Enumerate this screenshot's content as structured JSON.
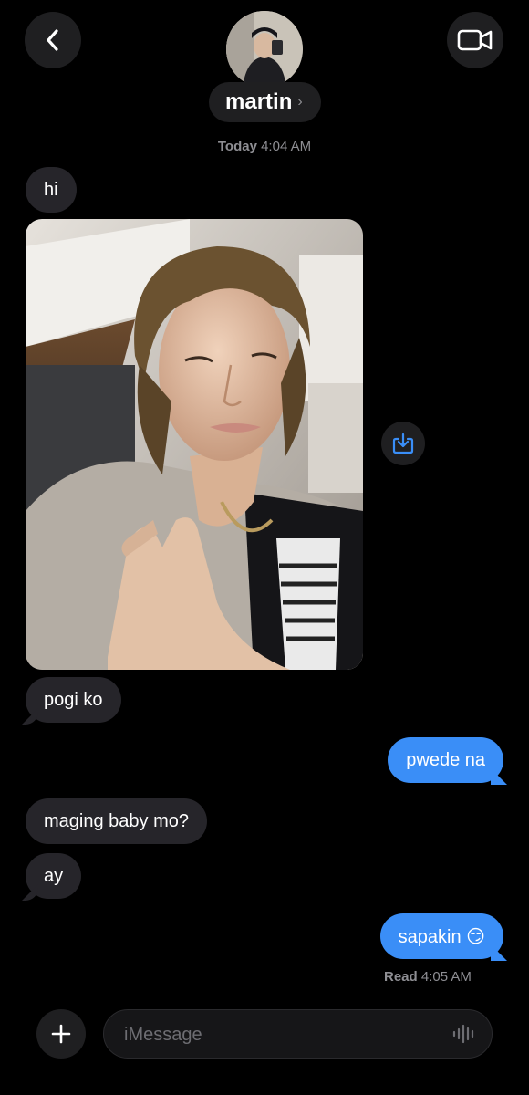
{
  "header": {
    "contact_name": "martin",
    "name_chevron": "›",
    "back_icon": "chevron-left-icon",
    "video_icon": "video-camera-icon"
  },
  "timestamp": {
    "day": "Today",
    "time": "4:04 AM"
  },
  "messages": [
    {
      "direction": "incoming",
      "text": "hi"
    },
    {
      "direction": "incoming",
      "type": "photo"
    },
    {
      "direction": "incoming",
      "text": "pogi ko"
    },
    {
      "direction": "outgoing",
      "text": "pwede na"
    },
    {
      "direction": "incoming",
      "text": "maging baby mo?"
    },
    {
      "direction": "incoming",
      "text": "ay"
    },
    {
      "direction": "outgoing",
      "text": "sapakin 😏"
    }
  ],
  "read_receipt": {
    "label": "Read",
    "time": "4:05 AM"
  },
  "composer": {
    "placeholder": "iMessage",
    "plus_icon": "plus-icon",
    "audio_icon": "waveform-icon"
  },
  "colors": {
    "background": "#000000",
    "incoming_bubble": "#26252a",
    "outgoing_bubble": "#3a8ef7",
    "secondary_text": "#8e8e93"
  }
}
